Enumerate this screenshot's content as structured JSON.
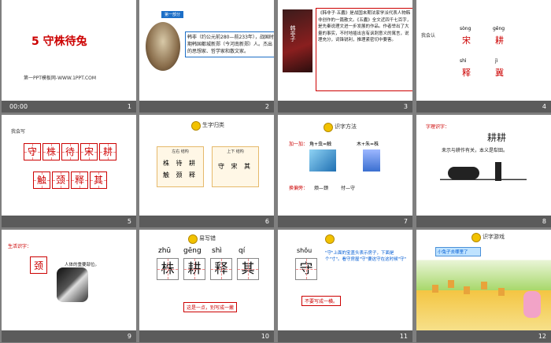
{
  "slides": [
    {
      "num": "1",
      "time": "00:00",
      "title": "5 守株待兔",
      "footer": "第一PPT模板网-WWW.1PPT.COM"
    },
    {
      "num": "2",
      "badge": "第一部分",
      "text1": "韩非（约公元前280—前233年），战国时期韩国都城新郑（今河南新郑）人。杰出的思想家、哲学家和散文家。"
    },
    {
      "num": "3",
      "book": "韩非子",
      "text": "《韩非子·五蠹》是战国末期法家学派代表人物韩非创作的一篇散文。《五蠹》全文近四千七百字，是先秦说理文进一步发展的作品。作者举出了大量的事实，不时地插出含有讽刺意义的寓言，说理充分，词锋锐利，推理紧密切中要害。"
    },
    {
      "num": "4",
      "label": "我会认",
      "pinyin": [
        "sòng",
        "gēng",
        "shì",
        "jì"
      ],
      "chars": [
        "宋",
        "耕",
        "释",
        "冀"
      ]
    },
    {
      "num": "5",
      "label": "我会写",
      "row1": [
        "守",
        "株",
        "待",
        "宋",
        "耕"
      ],
      "row2": [
        "触",
        "颈",
        "释",
        "其"
      ]
    },
    {
      "num": "6",
      "heading": "生字归类",
      "left_head": "左右  结构",
      "left_chars": [
        "株",
        "待",
        "耕",
        "触",
        "颈",
        "释"
      ],
      "right_head": "上下  结构",
      "right_chars": [
        "守",
        "宋",
        "其"
      ]
    },
    {
      "num": "7",
      "heading": "识字方法",
      "add_label": "加一加：",
      "add1": "角+虫=触",
      "add2": "木+朱=株",
      "swap_label": "换偏旁：",
      "swap1": "烦—颈",
      "swap2": "付—守"
    },
    {
      "num": "8",
      "label": "字理识字：",
      "chars": "耕耕",
      "note": "耒示与耕作有关，本义是犁田。"
    },
    {
      "num": "9",
      "label": "生活识字：",
      "char": "颈",
      "note": "人体的重要部位。"
    },
    {
      "num": "10",
      "heading": "易写错",
      "pinyin": [
        "zhū",
        "gēng",
        "shì",
        "qí"
      ],
      "chars": [
        "株",
        "耕",
        "释",
        "其"
      ],
      "note": "这是一点，别写成一撇"
    },
    {
      "num": "11",
      "pinyin": "shǒu",
      "char": "守",
      "explain": "\"守\"上面的宝盖头表示房子，下面是个\"寸\"。看守房屋\"守\"要这守在这时候\"守\"",
      "note": "不要写成一横。"
    },
    {
      "num": "12",
      "heading": "识字游戏",
      "banner": "小兔子去哪里了"
    }
  ]
}
